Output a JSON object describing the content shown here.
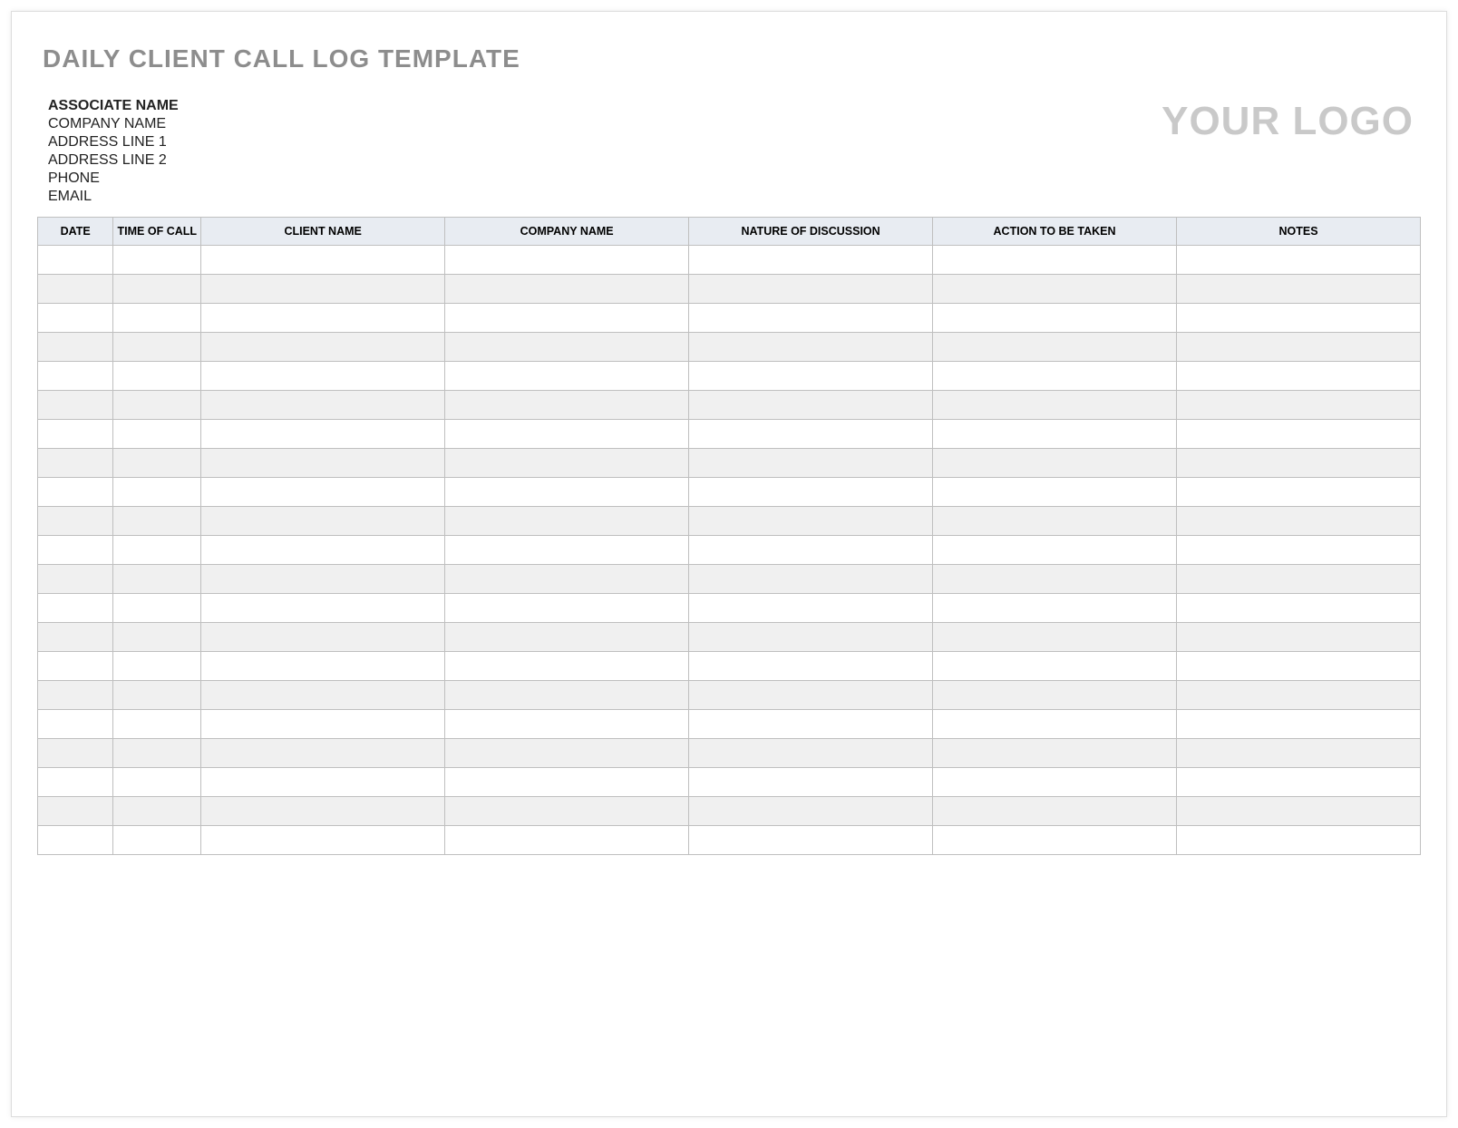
{
  "title": "DAILY CLIENT CALL LOG TEMPLATE",
  "logo_text": "YOUR LOGO",
  "associate": {
    "name": "ASSOCIATE NAME",
    "company": "COMPANY NAME",
    "address1": "ADDRESS LINE 1",
    "address2": "ADDRESS LINE 2",
    "phone": "PHONE",
    "email": "EMAIL"
  },
  "table": {
    "headers": {
      "date": "DATE",
      "time": "TIME OF CALL",
      "client": "CLIENT NAME",
      "company": "COMPANY NAME",
      "nature": "NATURE OF DISCUSSION",
      "action": "ACTION TO BE TAKEN",
      "notes": "NOTES"
    },
    "row_count": 21
  }
}
